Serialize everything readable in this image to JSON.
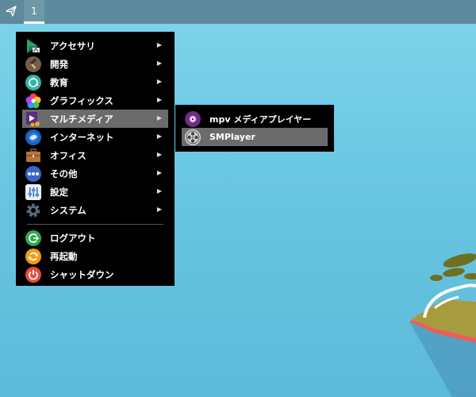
{
  "panel": {
    "launcher_icon": "paper-plane-icon",
    "workspace_label": "1"
  },
  "main_menu": {
    "items": [
      {
        "label": "アクセサリ",
        "icon": "accessories-icon",
        "has_submenu": true
      },
      {
        "label": "開発",
        "icon": "hammer-icon",
        "has_submenu": true
      },
      {
        "label": "教育",
        "icon": "education-icon",
        "has_submenu": true
      },
      {
        "label": "グラフィックス",
        "icon": "graphics-flower-icon",
        "has_submenu": true
      },
      {
        "label": "マルチメディア",
        "icon": "multimedia-icon",
        "has_submenu": true,
        "active": true
      },
      {
        "label": "インターネット",
        "icon": "globe-icon",
        "has_submenu": true
      },
      {
        "label": "オフィス",
        "icon": "briefcase-icon",
        "has_submenu": true
      },
      {
        "label": "その他",
        "icon": "more-dots-icon",
        "has_submenu": true
      },
      {
        "label": "設定",
        "icon": "settings-sliders-icon",
        "has_submenu": true
      },
      {
        "label": "システム",
        "icon": "system-gear-icon",
        "has_submenu": true
      }
    ],
    "session_items": [
      {
        "label": "ログアウト",
        "icon": "logout-icon"
      },
      {
        "label": "再起動",
        "icon": "restart-icon"
      },
      {
        "label": "シャットダウン",
        "icon": "power-icon"
      }
    ]
  },
  "sub_menu": {
    "items": [
      {
        "label": "mpv メディアプレイヤー",
        "icon": "mpv-play-icon"
      },
      {
        "label": "SMPlayer",
        "icon": "smplayer-reel-icon",
        "active": true
      }
    ]
  },
  "colors": {
    "panel": "#5d8a9c",
    "menu_bg": "#000000",
    "active_item": "#6b6b6b",
    "desktop": "#6bc8e3"
  }
}
